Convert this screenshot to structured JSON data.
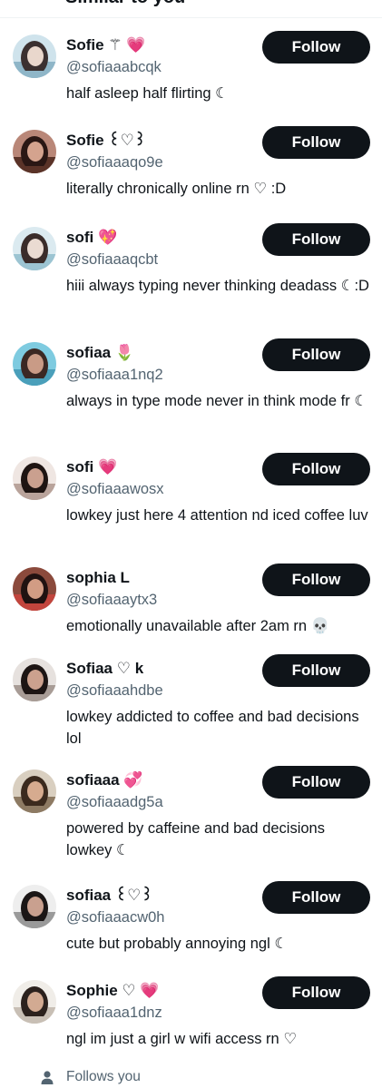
{
  "header": {
    "title": "Similar to you"
  },
  "follow_label": "Follow",
  "users": [
    {
      "name": "Sofie ⚚ 💗",
      "handle": "@sofiaaabcqk",
      "bio": "half asleep half flirting ☾",
      "avatar_colors": [
        "#cfe3ec",
        "#8fb6c8",
        "#3b3030",
        "#e9d7cc"
      ]
    },
    {
      "name": "Sofie ꒰♡꒱",
      "handle": "@sofiaaaqo9e",
      "bio": "literally chronically online rn ♡ :D",
      "avatar_colors": [
        "#b98778",
        "#5a3328",
        "#2a1714",
        "#d4a38e"
      ]
    },
    {
      "name": "sofi 💖",
      "handle": "@sofiaaaqcbt",
      "bio": "hiii always typing never thinking deadass ☾:D",
      "avatar_colors": [
        "#dbeaf0",
        "#9cc4d2",
        "#3a2c2a",
        "#eadbd2"
      ]
    },
    {
      "name": "sofiaa 🌷",
      "handle": "@sofiaaa1nq2",
      "bio": "always in type mode never in think mode fr ☾",
      "avatar_colors": [
        "#7ecbe0",
        "#4a9fba",
        "#3b2823",
        "#c99b86"
      ]
    },
    {
      "name": "sofi 💗",
      "handle": "@sofiaaawosx",
      "bio": "lowkey just here 4 attention nd iced coffee luv",
      "avatar_colors": [
        "#efe6e2",
        "#b9a39b",
        "#1e1412",
        "#caa08f"
      ]
    },
    {
      "name": "sophia L",
      "handle": "@sofiaaaytx3",
      "bio": "emotionally unavailable after 2am rn 💀",
      "avatar_colors": [
        "#8b4a3c",
        "#c2453d",
        "#201211",
        "#d29c84"
      ]
    },
    {
      "name": "Sofiaa ♡ k",
      "handle": "@sofiaaahdbe",
      "bio": "lowkey addicted to coffee and bad decisions lol",
      "avatar_colors": [
        "#e6e1de",
        "#a89c96",
        "#1d1514",
        "#cca18e"
      ]
    },
    {
      "name": "sofiaaa 💞",
      "handle": "@sofiaaadg5a",
      "bio": "powered by caffeine and bad decisions lowkey ☾",
      "avatar_colors": [
        "#d9cfc0",
        "#8d7a63",
        "#3b2a1e",
        "#d6ab8f"
      ]
    },
    {
      "name": "sofiaa ꒰♡꒱",
      "handle": "@sofiaaacw0h",
      "bio": "cute but probably annoying ngl ☾",
      "avatar_colors": [
        "#eeeeee",
        "#9a9a9a",
        "#1b1616",
        "#c9a08f"
      ]
    },
    {
      "name": "Sophie ♡ 💗",
      "handle": "@sofiaaa1dnz",
      "bio": "ngl im just a girl w wifi access rn ♡",
      "avatar_colors": [
        "#f0ede8",
        "#c8bfb5",
        "#2b211d",
        "#d2aa92"
      ]
    }
  ],
  "footer": {
    "text": "Follows you",
    "icon": "person-icon"
  }
}
